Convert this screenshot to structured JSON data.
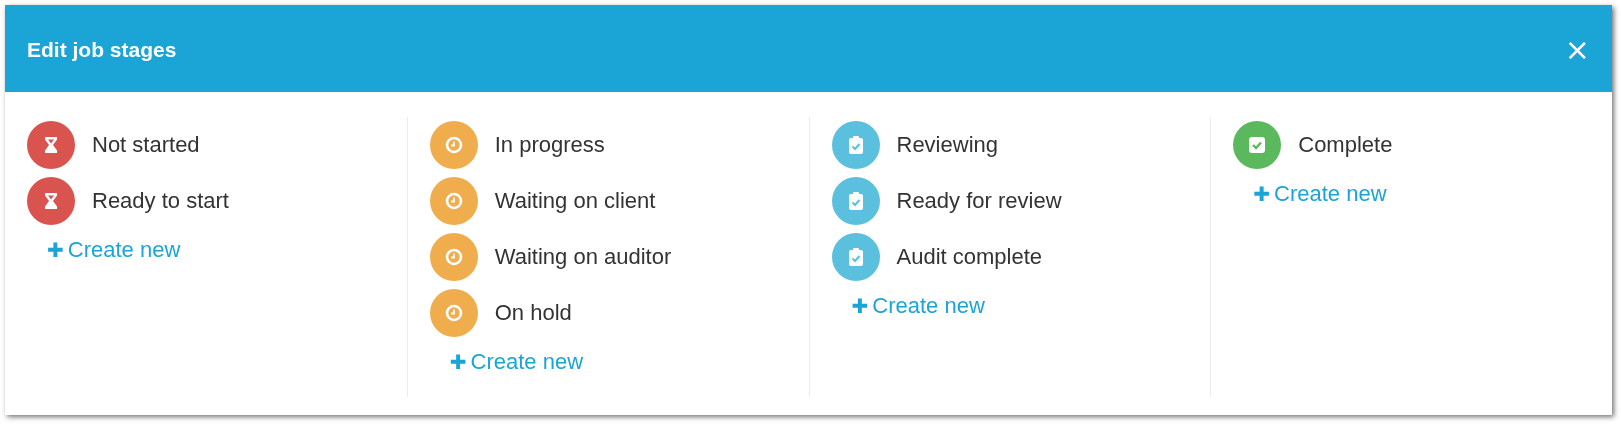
{
  "dialog": {
    "title": "Edit job stages",
    "close": "×"
  },
  "columns": [
    {
      "kind": "hourglass",
      "color": "#d9534f",
      "stages": [
        "Not started",
        "Ready to start"
      ],
      "create": {
        "icon": "✚",
        "label": "Create new"
      }
    },
    {
      "kind": "clock",
      "color": "#f0ad4e",
      "stages": [
        "In progress",
        "Waiting on client",
        "Waiting on auditor",
        "On hold"
      ],
      "create": {
        "icon": "✚",
        "label": "Create new"
      }
    },
    {
      "kind": "clipboard",
      "color": "#5bc0de",
      "stages": [
        "Reviewing",
        "Ready for review",
        "Audit complete"
      ],
      "create": {
        "icon": "✚",
        "label": "Create new"
      }
    },
    {
      "kind": "check",
      "color": "#5cb85c",
      "stages": [
        "Complete"
      ],
      "create": {
        "icon": "✚",
        "label": "Create new"
      }
    }
  ]
}
